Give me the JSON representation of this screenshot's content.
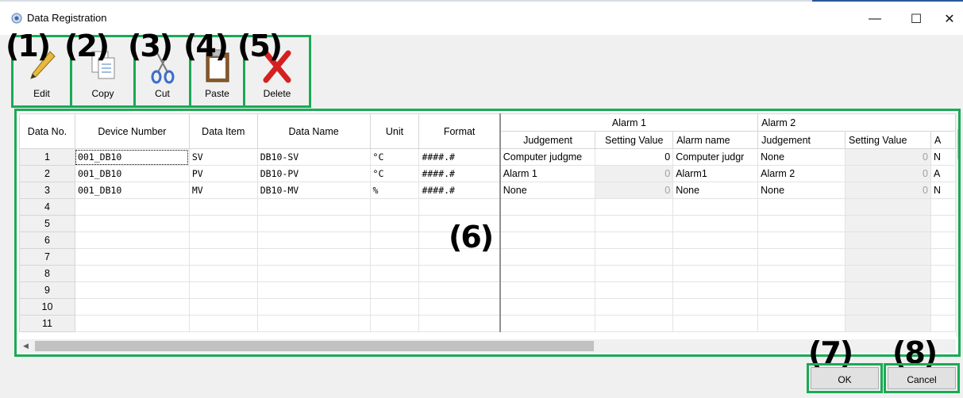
{
  "window": {
    "title": "Data Registration",
    "minimize_glyph": "—",
    "maximize_glyph": "☐",
    "close_glyph": "✕"
  },
  "toolbar": {
    "buttons": [
      {
        "num": "(1)",
        "label": "Edit",
        "icon": "pencil-icon"
      },
      {
        "num": "(2)",
        "label": "Copy",
        "icon": "copy-icon"
      },
      {
        "num": "(3)",
        "label": "Cut",
        "icon": "scissors-icon"
      },
      {
        "num": "(4)",
        "label": "Paste",
        "icon": "clipboard-icon"
      },
      {
        "num": "(5)",
        "label": "Delete",
        "icon": "delete-x-icon"
      }
    ]
  },
  "annotations": {
    "grid": "(6)",
    "ok": "(7)",
    "cancel": "(8)"
  },
  "grid": {
    "headers": {
      "data_no": "Data No.",
      "device_number": "Device Number",
      "data_item": "Data Item",
      "data_name": "Data Name",
      "unit": "Unit",
      "format": "Format",
      "alarm1": "Alarm 1",
      "alarm2": "Alarm 2",
      "judgement": "Judgement",
      "setting_value": "Setting Value",
      "alarm_name": "Alarm name",
      "alarm2_judgement": "Judgement",
      "alarm2_setting_value": "Setting Value",
      "alarm2_name_partial": "A"
    },
    "rows": [
      {
        "no": "1",
        "device": "001_DB10",
        "item": "SV",
        "name": "DB10-SV",
        "unit": "°C",
        "format": "####.#",
        "a1_judgement": "Computer judgme",
        "a1_setting": "0",
        "a1_name": "Computer judgr",
        "a2_judgement": "None",
        "a2_setting": "0",
        "a2_name": "N"
      },
      {
        "no": "2",
        "device": "001_DB10",
        "item": "PV",
        "name": "DB10-PV",
        "unit": "°C",
        "format": "####.#",
        "a1_judgement": "Alarm 1",
        "a1_setting": "0",
        "a1_name": "Alarm1",
        "a2_judgement": "Alarm 2",
        "a2_setting": "0",
        "a2_name": "A"
      },
      {
        "no": "3",
        "device": "001_DB10",
        "item": "MV",
        "name": "DB10-MV",
        "unit": "%",
        "format": "####.#",
        "a1_judgement": "None",
        "a1_setting": "0",
        "a1_name": "None",
        "a2_judgement": "None",
        "a2_setting": "0",
        "a2_name": "N"
      },
      {
        "no": "4"
      },
      {
        "no": "5"
      },
      {
        "no": "6"
      },
      {
        "no": "7"
      },
      {
        "no": "8"
      },
      {
        "no": "9"
      },
      {
        "no": "10"
      },
      {
        "no": "11"
      }
    ]
  },
  "buttons": {
    "ok": "OK",
    "cancel": "Cancel"
  },
  "scroll": {
    "up": "▲",
    "down": "▼",
    "left": "◀",
    "right": "▶"
  },
  "colors": {
    "highlight_border": "#1aaa55"
  }
}
